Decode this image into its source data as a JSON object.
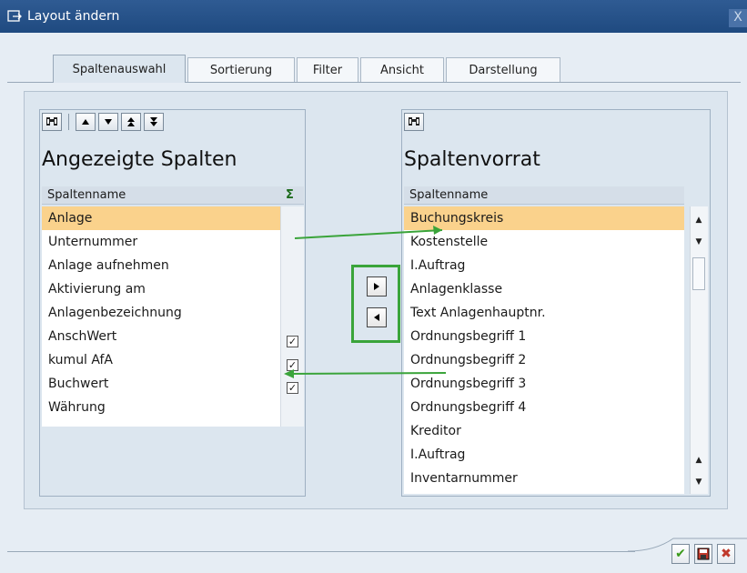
{
  "window": {
    "title": "Layout ändern",
    "close_label": "X"
  },
  "tabs": [
    {
      "label": "Spaltenauswahl",
      "active": true
    },
    {
      "label": "Sortierung",
      "active": false
    },
    {
      "label": "Filter",
      "active": false
    },
    {
      "label": "Ansicht",
      "active": false
    },
    {
      "label": "Darstellung",
      "active": false
    }
  ],
  "left": {
    "title": "Angezeigte Spalten",
    "header": "Spaltenname",
    "sum_header": "Σ",
    "rows": [
      {
        "label": "Anlage",
        "selected": true,
        "checked": null
      },
      {
        "label": "Unternummer",
        "selected": false,
        "checked": null
      },
      {
        "label": "Anlage aufnehmen",
        "selected": false,
        "checked": null
      },
      {
        "label": "Aktivierung am",
        "selected": false,
        "checked": null
      },
      {
        "label": "Anlagenbezeichnung",
        "selected": false,
        "checked": null
      },
      {
        "label": "AnschWert",
        "selected": false,
        "checked": true
      },
      {
        "label": "kumul AfA",
        "selected": false,
        "checked": true
      },
      {
        "label": "Buchwert",
        "selected": false,
        "checked": true
      },
      {
        "label": "Währung",
        "selected": false,
        "checked": null
      }
    ]
  },
  "right": {
    "title": "Spaltenvorrat",
    "header": "Spaltenname",
    "rows": [
      {
        "label": "Buchungskreis",
        "selected": true
      },
      {
        "label": "Kostenstelle",
        "selected": false
      },
      {
        "label": "I.Auftrag",
        "selected": false
      },
      {
        "label": "Anlagenklasse",
        "selected": false
      },
      {
        "label": "Text Anlagenhauptnr.",
        "selected": false
      },
      {
        "label": "Ordnungsbegriff 1",
        "selected": false
      },
      {
        "label": "Ordnungsbegriff 2",
        "selected": false
      },
      {
        "label": "Ordnungsbegriff 3",
        "selected": false
      },
      {
        "label": "Ordnungsbegriff 4",
        "selected": false
      },
      {
        "label": "Kreditor",
        "selected": false
      },
      {
        "label": "I.Auftrag",
        "selected": false
      },
      {
        "label": "Inventarnummer",
        "selected": false
      }
    ]
  },
  "icons": {
    "find": "find-icon",
    "up": "move-up-icon",
    "down": "move-down-icon",
    "top": "move-top-icon",
    "bottom": "move-bottom-icon",
    "move_right": "move-right-icon",
    "move_left": "move-left-icon",
    "confirm": "check-icon",
    "save": "save-icon",
    "cancel": "cancel-icon"
  },
  "colors": {
    "selection": "#fad28c",
    "annotation": "#3aa43a",
    "title_bar": "#1f4a80"
  }
}
